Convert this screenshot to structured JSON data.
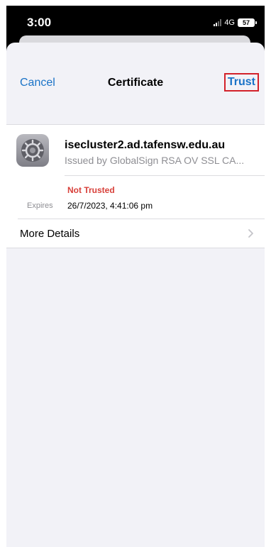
{
  "status_bar": {
    "time": "3:00",
    "network": "4G",
    "battery": "57"
  },
  "nav": {
    "cancel_label": "Cancel",
    "title": "Certificate",
    "trust_label": "Trust"
  },
  "certificate": {
    "icon": "settings-gear-icon",
    "name": "isecluster2.ad.tafensw.edu.au",
    "issuer": "Issued by GlobalSign RSA OV SSL CA...",
    "trust_status": "Not Trusted",
    "expires_label": "Expires",
    "expires_value": "26/7/2023, 4:41:06 pm"
  },
  "details": {
    "more_details_label": "More Details"
  },
  "colors": {
    "link": "#1a73c7",
    "warning": "#d8403a",
    "highlight_box": "#d3222a"
  }
}
